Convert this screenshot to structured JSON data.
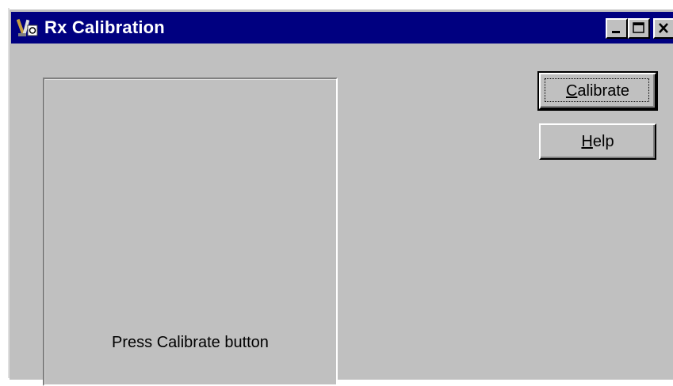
{
  "window": {
    "title": "Rx Calibration",
    "icon": "calibration-tool-icon",
    "controls": {
      "minimize": "minimize-icon",
      "maximize": "maximize-icon",
      "close": "close-icon"
    }
  },
  "panel": {
    "status_text": "Press Calibrate button"
  },
  "buttons": {
    "calibrate": {
      "mnemonic": "C",
      "rest": "alibrate",
      "is_default": true
    },
    "help": {
      "mnemonic": "H",
      "rest": "elp"
    }
  },
  "colors": {
    "titlebar": "#000080",
    "face": "#c0c0c0",
    "title_text": "#ffffff"
  }
}
